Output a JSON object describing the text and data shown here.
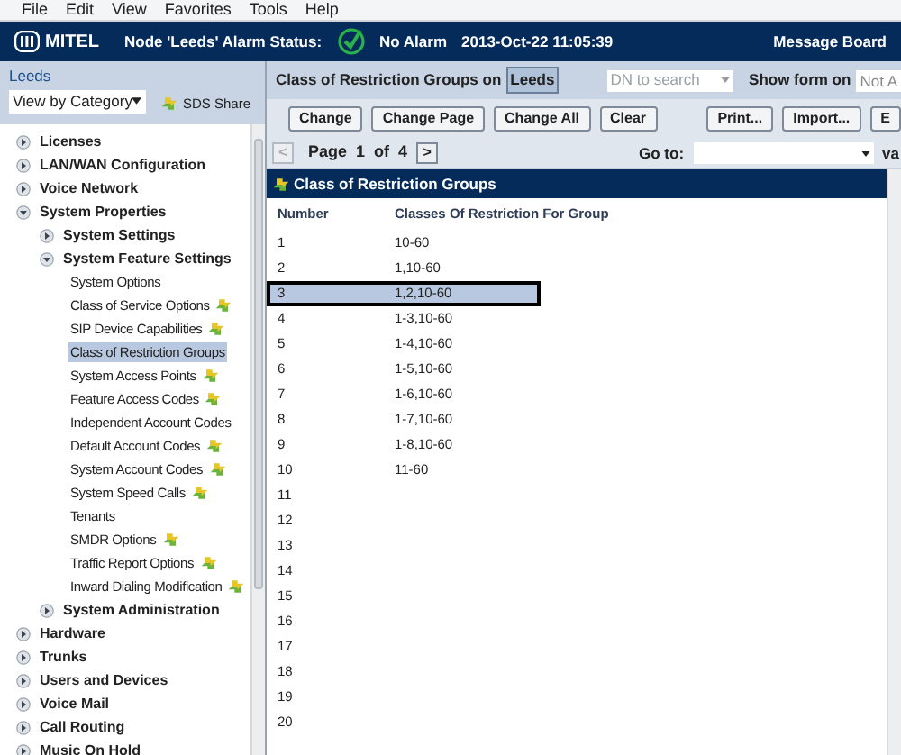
{
  "menu": [
    "File",
    "Edit",
    "View",
    "Favorites",
    "Tools",
    "Help"
  ],
  "header": {
    "brand": "MITEL",
    "status_label": "Node 'Leeds' Alarm Status:",
    "alarm": "No Alarm",
    "datetime": "2013-Oct-22 11:05:39",
    "link": "Message Board"
  },
  "sidebar": {
    "node": "Leeds",
    "view": "View by Category",
    "share": "SDS Share",
    "tree": [
      {
        "label": "Licenses",
        "expanded": false
      },
      {
        "label": "LAN/WAN Configuration",
        "expanded": false
      },
      {
        "label": "Voice Network",
        "expanded": false
      },
      {
        "label": "System Properties",
        "expanded": true,
        "children": [
          {
            "label": "System Settings",
            "expanded": false
          },
          {
            "label": "System Feature Settings",
            "expanded": true,
            "children": [
              {
                "label": "System Options",
                "shared": false,
                "selected": false
              },
              {
                "label": "Class of Service Options",
                "shared": true,
                "selected": false
              },
              {
                "label": "SIP Device Capabilities",
                "shared": true,
                "selected": false
              },
              {
                "label": "Class of Restriction Groups",
                "shared": false,
                "selected": true
              },
              {
                "label": "System Access Points",
                "shared": true,
                "selected": false
              },
              {
                "label": "Feature Access Codes",
                "shared": true,
                "selected": false
              },
              {
                "label": "Independent Account Codes",
                "shared": false,
                "selected": false
              },
              {
                "label": "Default Account Codes",
                "shared": true,
                "selected": false
              },
              {
                "label": "System Account Codes",
                "shared": true,
                "selected": false
              },
              {
                "label": "System Speed Calls",
                "shared": true,
                "selected": false
              },
              {
                "label": "Tenants",
                "shared": false,
                "selected": false
              },
              {
                "label": "SMDR Options",
                "shared": true,
                "selected": false
              },
              {
                "label": "Traffic Report Options",
                "shared": true,
                "selected": false
              },
              {
                "label": "Inward Dialing Modification",
                "shared": true,
                "selected": false
              }
            ]
          },
          {
            "label": "System Administration",
            "expanded": false
          }
        ]
      },
      {
        "label": "Hardware",
        "expanded": false
      },
      {
        "label": "Trunks",
        "expanded": false
      },
      {
        "label": "Users and Devices",
        "expanded": false
      },
      {
        "label": "Voice Mail",
        "expanded": false
      },
      {
        "label": "Call Routing",
        "expanded": false
      },
      {
        "label": "Music On Hold",
        "expanded": false
      }
    ]
  },
  "toolbar": {
    "title": "Class of Restriction Groups on",
    "node": "Leeds",
    "search_placeholder": "DN to search",
    "show_form_label": "Show form on",
    "show_form_value": "Not A"
  },
  "buttons": [
    "Change",
    "Change Page",
    "Change All",
    "Clear",
    "Print...",
    "Import...",
    "E"
  ],
  "pager": {
    "prev": "<",
    "page_label": "Page",
    "page": "1",
    "of_label": "of",
    "pages": "4",
    "next": ">",
    "goto_label": "Go to:",
    "cut_label": "va"
  },
  "table": {
    "title": "Class of Restriction Groups",
    "columns": [
      "Number",
      "Classes Of Restriction For Group"
    ],
    "rows": [
      {
        "number": "1",
        "value": "10-60",
        "selected": false
      },
      {
        "number": "2",
        "value": "1,10-60",
        "selected": false
      },
      {
        "number": "3",
        "value": "1,2,10-60",
        "selected": true
      },
      {
        "number": "4",
        "value": "1-3,10-60",
        "selected": false
      },
      {
        "number": "5",
        "value": "1-4,10-60",
        "selected": false
      },
      {
        "number": "6",
        "value": "1-5,10-60",
        "selected": false
      },
      {
        "number": "7",
        "value": "1-6,10-60",
        "selected": false
      },
      {
        "number": "8",
        "value": "1-7,10-60",
        "selected": false
      },
      {
        "number": "9",
        "value": "1-8,10-60",
        "selected": false
      },
      {
        "number": "10",
        "value": "11-60",
        "selected": false
      },
      {
        "number": "11",
        "selected": false
      },
      {
        "number": "12",
        "selected": false
      },
      {
        "number": "13",
        "selected": false
      },
      {
        "number": "14",
        "selected": false
      },
      {
        "number": "15",
        "selected": false
      },
      {
        "number": "16",
        "selected": false
      },
      {
        "number": "17",
        "selected": false
      },
      {
        "number": "18",
        "selected": false
      },
      {
        "number": "19",
        "selected": false
      },
      {
        "number": "20",
        "selected": false
      }
    ]
  }
}
